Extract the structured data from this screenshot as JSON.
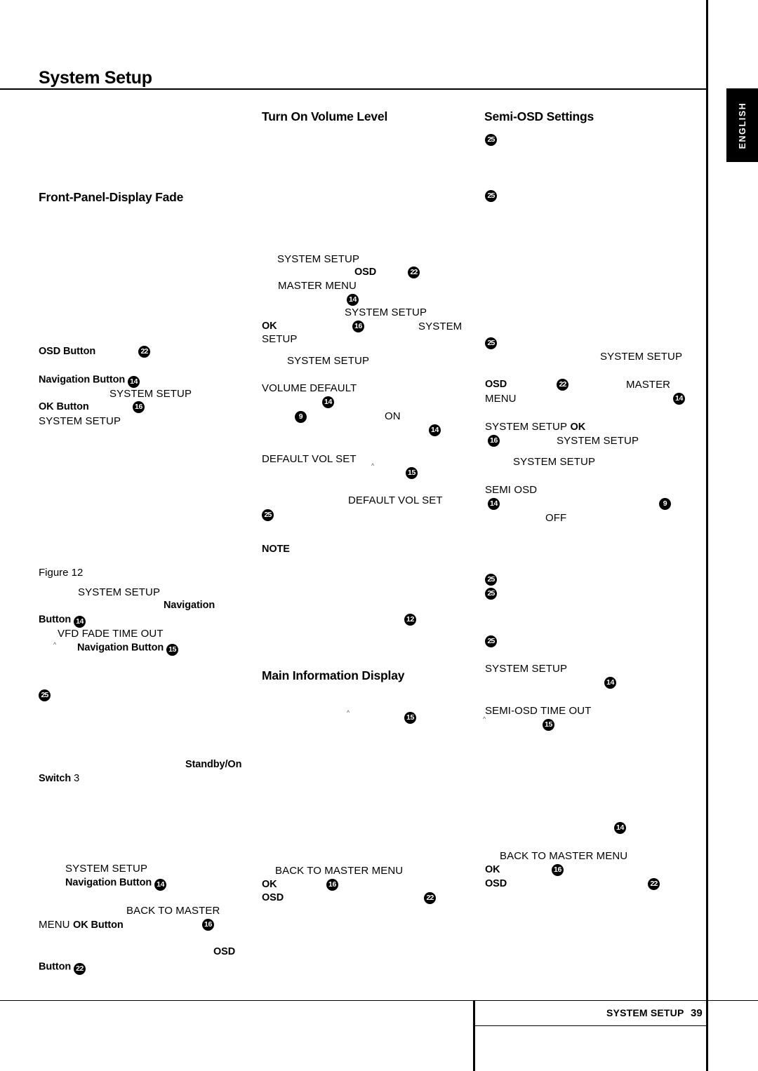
{
  "page": {
    "title": "System Setup",
    "language_tab": "ENGLISH",
    "footer_label": "SYSTEM SETUP",
    "footer_page_number": "39"
  },
  "headings": {
    "front_panel_display_fade": "Front-Panel-Display Fade",
    "turn_on_volume_level": "Turn On Volume Level",
    "semi_osd_settings": "Semi-OSD Settings",
    "main_information_display": "Main Information Display",
    "note": "NOTE"
  },
  "left_column": {
    "osd_button": "OSD Button",
    "osd_button_ref": "22",
    "navigation_button": "Navigation Button",
    "navigation_button_ref": "14",
    "system_setup_1": "SYSTEM SETUP",
    "ok_button": "OK Button",
    "ok_button_ref": "16",
    "system_setup_2": "SYSTEM SETUP",
    "figure_caption": "Figure 12",
    "system_setup_3": "SYSTEM SETUP",
    "navigation_word": "Navigation",
    "button_word": "Button",
    "button_ref": "14",
    "vfd_fade_time_out": "VFD FADE TIME OUT",
    "navigation_button_2": "Navigation Button",
    "navigation_button_2_ref": "15",
    "ref_25_a": "25",
    "standby_on": "Standby/On",
    "switch_word": "Switch",
    "switch_ref": "3",
    "system_setup_4": "SYSTEM SETUP",
    "navigation_button_3": "Navigation Button",
    "navigation_button_3_ref": "14",
    "back_to_master": "BACK TO MASTER",
    "menu_word": "MENU",
    "ok_button_2": "OK Button",
    "ok_button_2_ref": "16",
    "osd_word": "OSD",
    "button_word_2": "Button",
    "button_2_ref": "22"
  },
  "middle_column": {
    "system_setup_1": "SYSTEM SETUP",
    "osd_bold": "OSD",
    "osd_ref": "22",
    "master_menu": "MASTER MENU",
    "ref_14_a": "14",
    "system_setup_2": "SYSTEM SETUP",
    "ok_bold": "OK",
    "ok_ref": "16",
    "system_word": "SYSTEM",
    "setup_word": "SETUP",
    "system_setup_3": "SYSTEM SETUP",
    "volume_default": "VOLUME DEFAULT",
    "ref_14_b": "14",
    "ref_9": "9",
    "on_word": "ON",
    "ref_14_c": "14",
    "default_vol_set_1": "DEFAULT VOL SET",
    "ref_15": "15",
    "default_vol_set_2": "DEFAULT VOL SET",
    "ref_25": "25",
    "ref_12": "12",
    "ref_15_b": "15",
    "back_to_master_menu": "BACK TO MASTER MENU",
    "ok_bold_2": "OK",
    "ok_ref_2": "16",
    "osd_bold_2": "OSD",
    "osd_ref_2": "22"
  },
  "right_column": {
    "ref_25_a": "25",
    "ref_25_b": "25",
    "ref_25_c": "25",
    "system_setup_1": "SYSTEM SETUP",
    "osd_bold": "OSD",
    "osd_ref": "22",
    "master_word": "MASTER",
    "menu_word": "MENU",
    "ref_14_a": "14",
    "system_setup_2": "SYSTEM SETUP",
    "ok_bold": "OK",
    "ok_ref": "16",
    "system_setup_3": "SYSTEM SETUP",
    "system_setup_4": "SYSTEM SETUP",
    "semi_osd": "SEMI OSD",
    "ref_14_b": "14",
    "ref_9": "9",
    "off_word": "OFF",
    "ref_25_d": "25",
    "ref_25_e": "25",
    "ref_25_f": "25",
    "system_setup_5": "SYSTEM SETUP",
    "ref_14_c": "14",
    "semi_osd_time_out": "SEMI-OSD TIME OUT",
    "ref_15": "15",
    "ref_14_d": "14",
    "back_to_master_menu": "BACK TO MASTER MENU",
    "ok_bold_2": "OK",
    "ok_ref_2": "16",
    "osd_bold_2": "OSD",
    "osd_ref_2": "22"
  }
}
